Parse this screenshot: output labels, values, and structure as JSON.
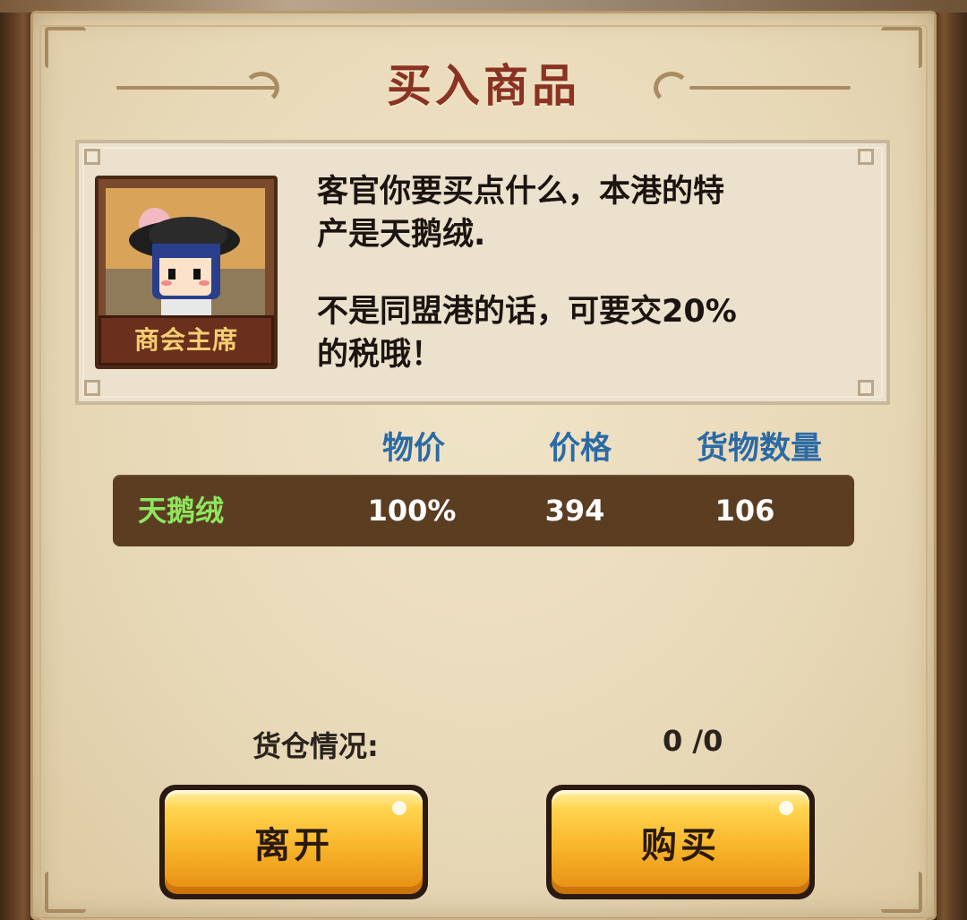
{
  "title": "买入商品",
  "merchant": {
    "role_label": "商会主席",
    "dialog_line1": "客官你要买点什么，本港的特",
    "dialog_line2": "产是天鹅绒.",
    "dialog_line3": "不是同盟港的话，可要交20%",
    "dialog_line4": "的税哦！"
  },
  "table": {
    "headers": {
      "price_rate": "物价",
      "price": "价格",
      "quantity": "货物数量"
    },
    "rows": [
      {
        "name": "天鹅绒",
        "price_rate": "100%",
        "price": "394",
        "quantity": "106"
      }
    ]
  },
  "cargo": {
    "label": "货仓情况:",
    "value": "0 /0"
  },
  "buttons": {
    "leave": "离开",
    "buy": "购买"
  },
  "colors": {
    "title": "#8a3322",
    "header_text": "#2b6aa5",
    "goods_name": "#8fe65e",
    "row_bg": "#5b3d22",
    "button_face": "#f8b52a"
  }
}
